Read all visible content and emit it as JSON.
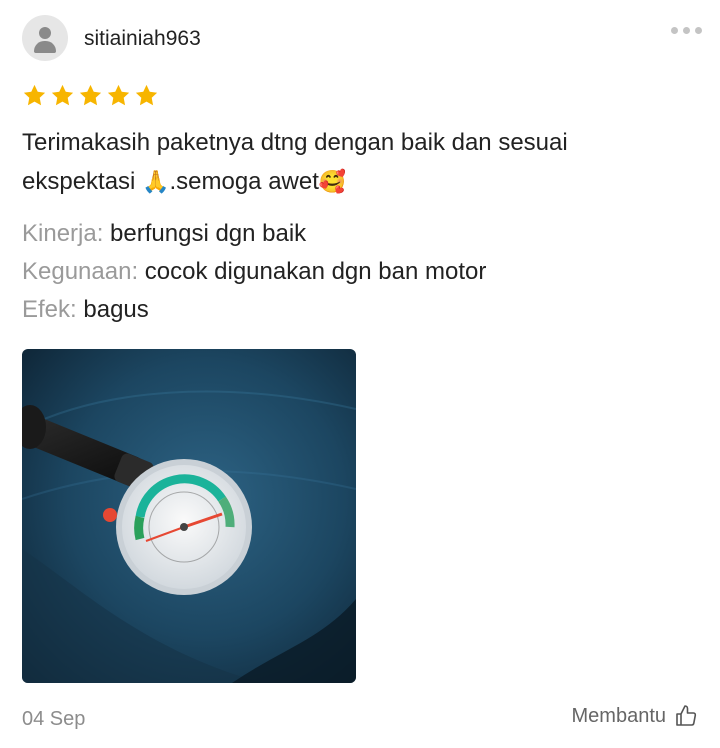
{
  "review": {
    "username": "sitiainiah963",
    "rating": 5,
    "text_line1": "Terimakasih paketnya dtng dengan baik dan sesuai",
    "text_line2_a": "ekspektasi ",
    "emoji_pray": "🙏",
    "text_line2_b": ".semoga awet",
    "emoji_smile": "🥰",
    "attributes": [
      {
        "key": "Kinerja:",
        "value": "berfungsi dgn baik"
      },
      {
        "key": "Kegunaan:",
        "value": "cocok digunakan dgn ban motor"
      },
      {
        "key": "Efek:",
        "value": "bagus"
      }
    ],
    "photo_icon": "tire-pressure-gauge-photo",
    "date": "04 Sep",
    "helpful_label": "Membantu"
  },
  "colors": {
    "star": "#f7b500",
    "muted": "#9a9a9a",
    "text": "#222222"
  },
  "icons": {
    "avatar": "user-avatar-icon",
    "more": "more-dots-icon",
    "helpful": "thumbs-up-icon"
  }
}
